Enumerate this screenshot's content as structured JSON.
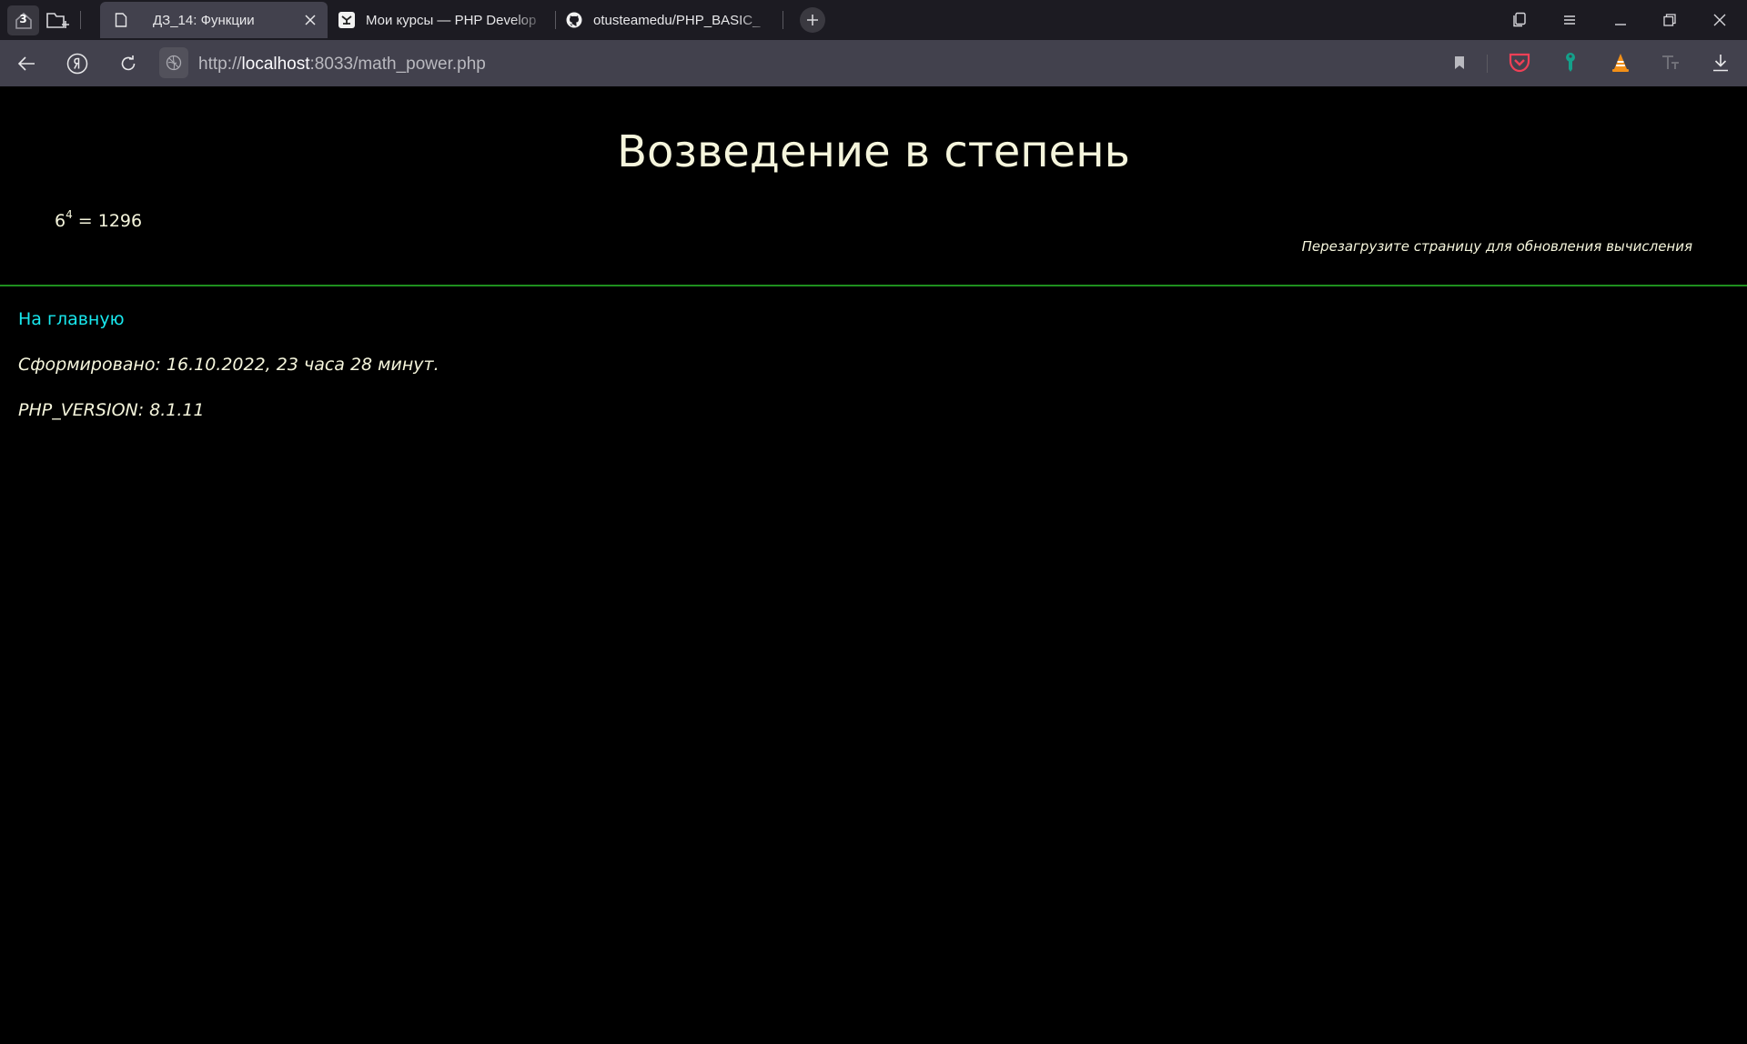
{
  "browser": {
    "tab_count": "3",
    "tabs": [
      {
        "label": "ДЗ_14: Функции",
        "favicon": "document-icon"
      },
      {
        "label": "Мои курсы — PHP Develop",
        "favicon": "otus-icon"
      },
      {
        "label": "otusteamedu/PHP_BASIC_",
        "favicon": "github-icon"
      }
    ],
    "url": {
      "scheme": "http://",
      "host": "localhost",
      "rest": ":8033/math_power.php"
    },
    "toolbar_icons": [
      "bookmark-icon",
      "pocket-icon",
      "key-icon",
      "vlc-icon",
      "translate-icon",
      "download-icon"
    ]
  },
  "page": {
    "title": "Возведение в степень",
    "formula": {
      "base": "6",
      "exponent": "4",
      "result": "= 1296"
    },
    "reload_hint": "Перезагрузите страницу для обновления вычисления",
    "home_link": "На главную",
    "generated": "Сформировано: 16.10.2022, 23 часа 28 минут.",
    "php_version": "PHP_VERSION: 8.1.11"
  },
  "colors": {
    "background": "#000000",
    "text": "#f5f5dc",
    "link": "#18e8ee",
    "divider": "#1e8f1e"
  }
}
